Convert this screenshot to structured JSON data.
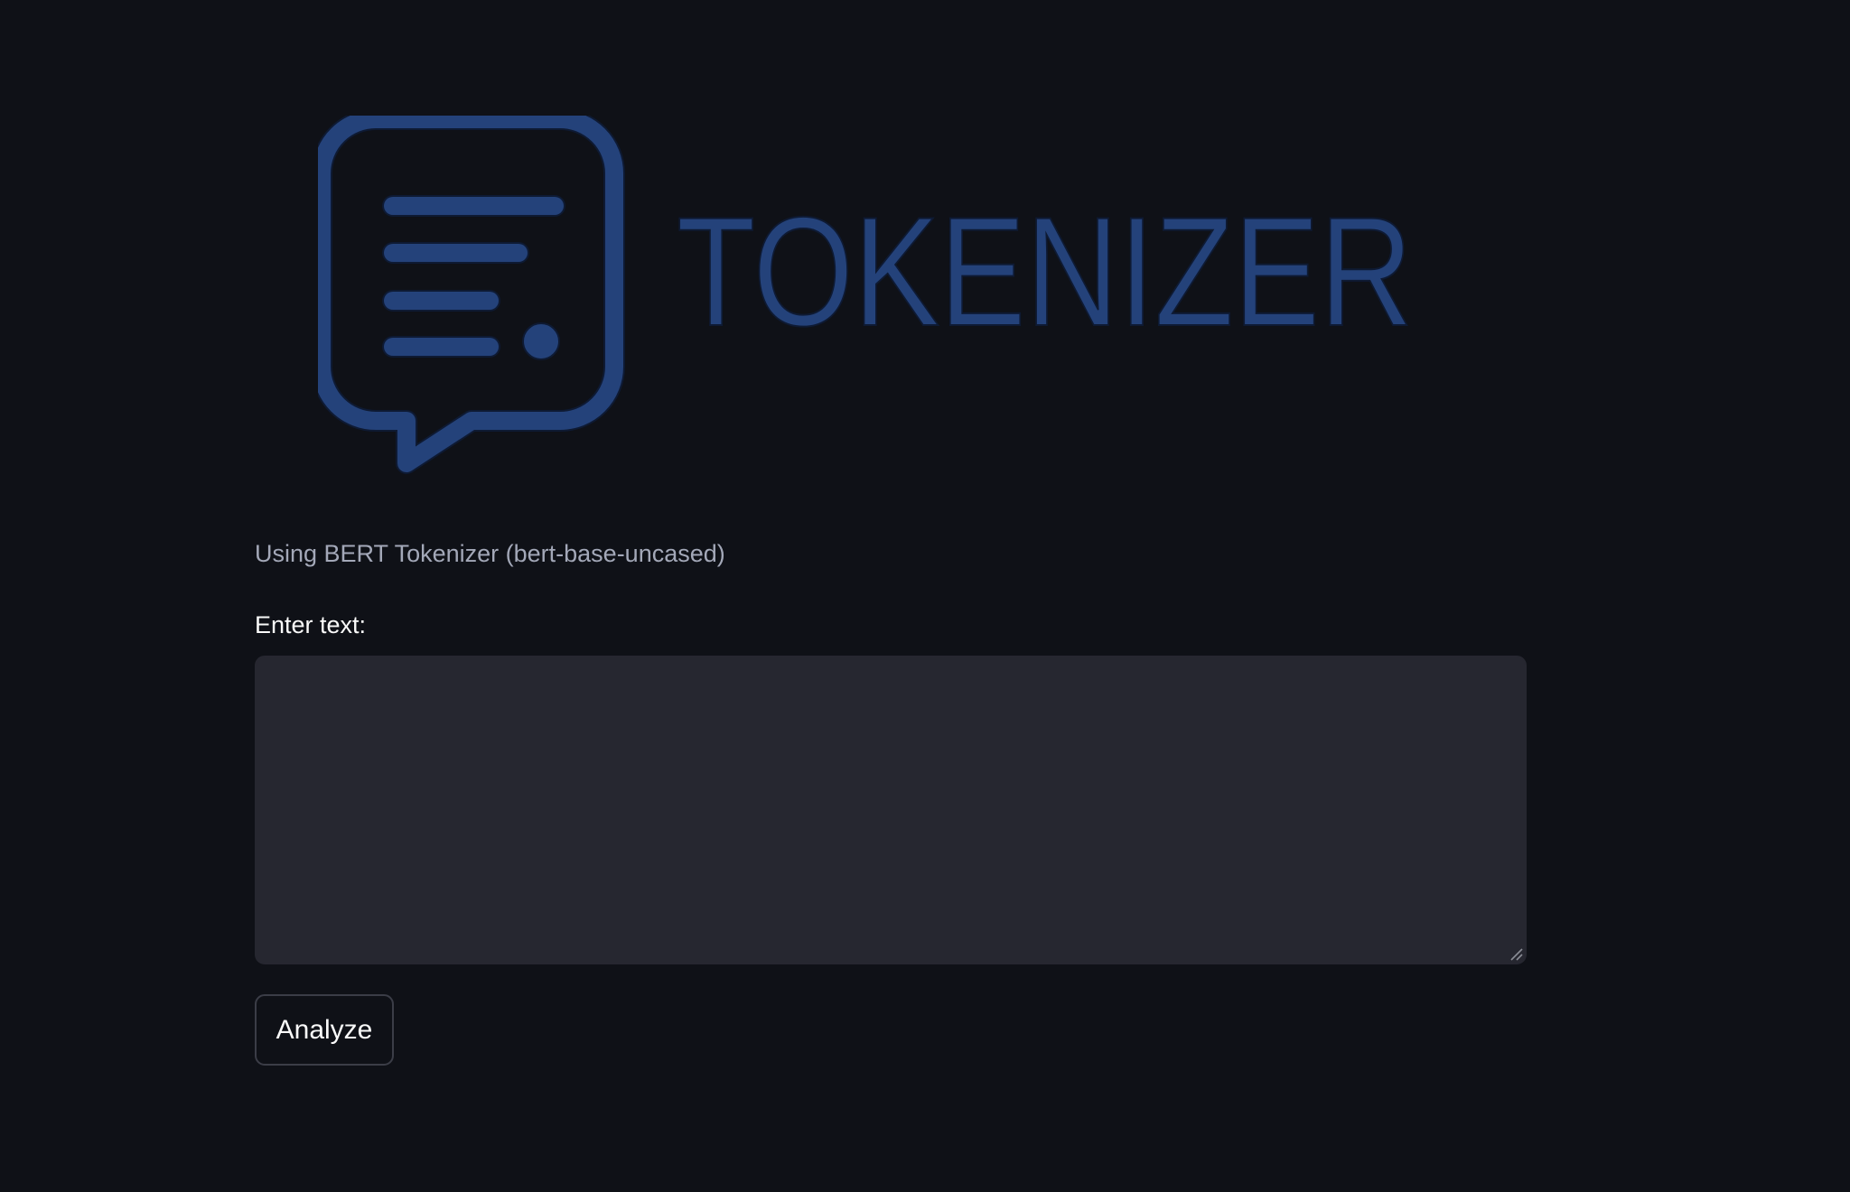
{
  "logo": {
    "wordmark": "TOKENIZER",
    "icon": "chat-bubble-lines-icon",
    "color": "#24427a",
    "outline_color": "#0e1a33"
  },
  "info": {
    "text": "Using BERT Tokenizer (bert-base-uncased)"
  },
  "input": {
    "label": "Enter text:",
    "value": "",
    "placeholder": ""
  },
  "actions": {
    "analyze_label": "Analyze"
  },
  "colors": {
    "background": "#0f1117",
    "input_background": "#262730",
    "text_primary": "#fafafa",
    "text_secondary": "#a3a8b8"
  }
}
